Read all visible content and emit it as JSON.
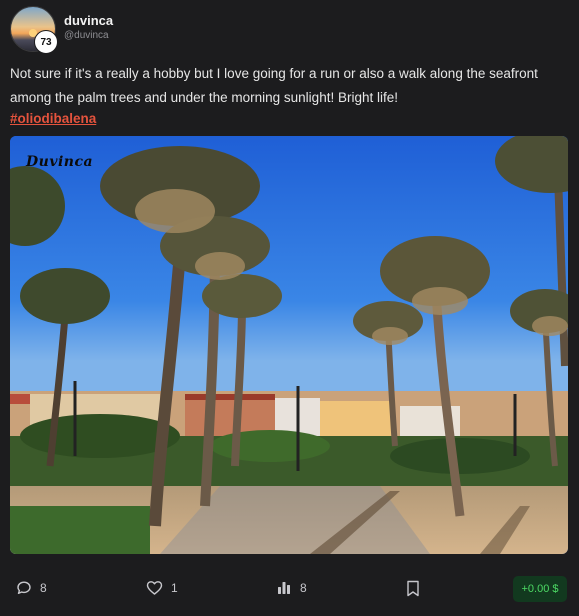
{
  "author": {
    "name": "duvinca",
    "handle": "@duvinca",
    "level": "73"
  },
  "post": {
    "text": "Not sure if it's a really a hobby but I love going for a run or also a walk along the seafront among the palm trees and under the morning sunlight! Bright life!",
    "hashtag": "#oliodibalena",
    "image_watermark": "Duvinca"
  },
  "actions": {
    "comments": "8",
    "likes": "1",
    "views": "8",
    "tip": "+0.00 $"
  },
  "icons": {
    "comments": "comment-icon",
    "likes": "heart-icon",
    "views": "bar-chart-icon",
    "bookmark": "bookmark-icon"
  },
  "colors": {
    "background": "#1c1c1e",
    "hashtag": "#e5533d",
    "tip_text": "#4cd964",
    "tip_bg": "#12391f"
  }
}
